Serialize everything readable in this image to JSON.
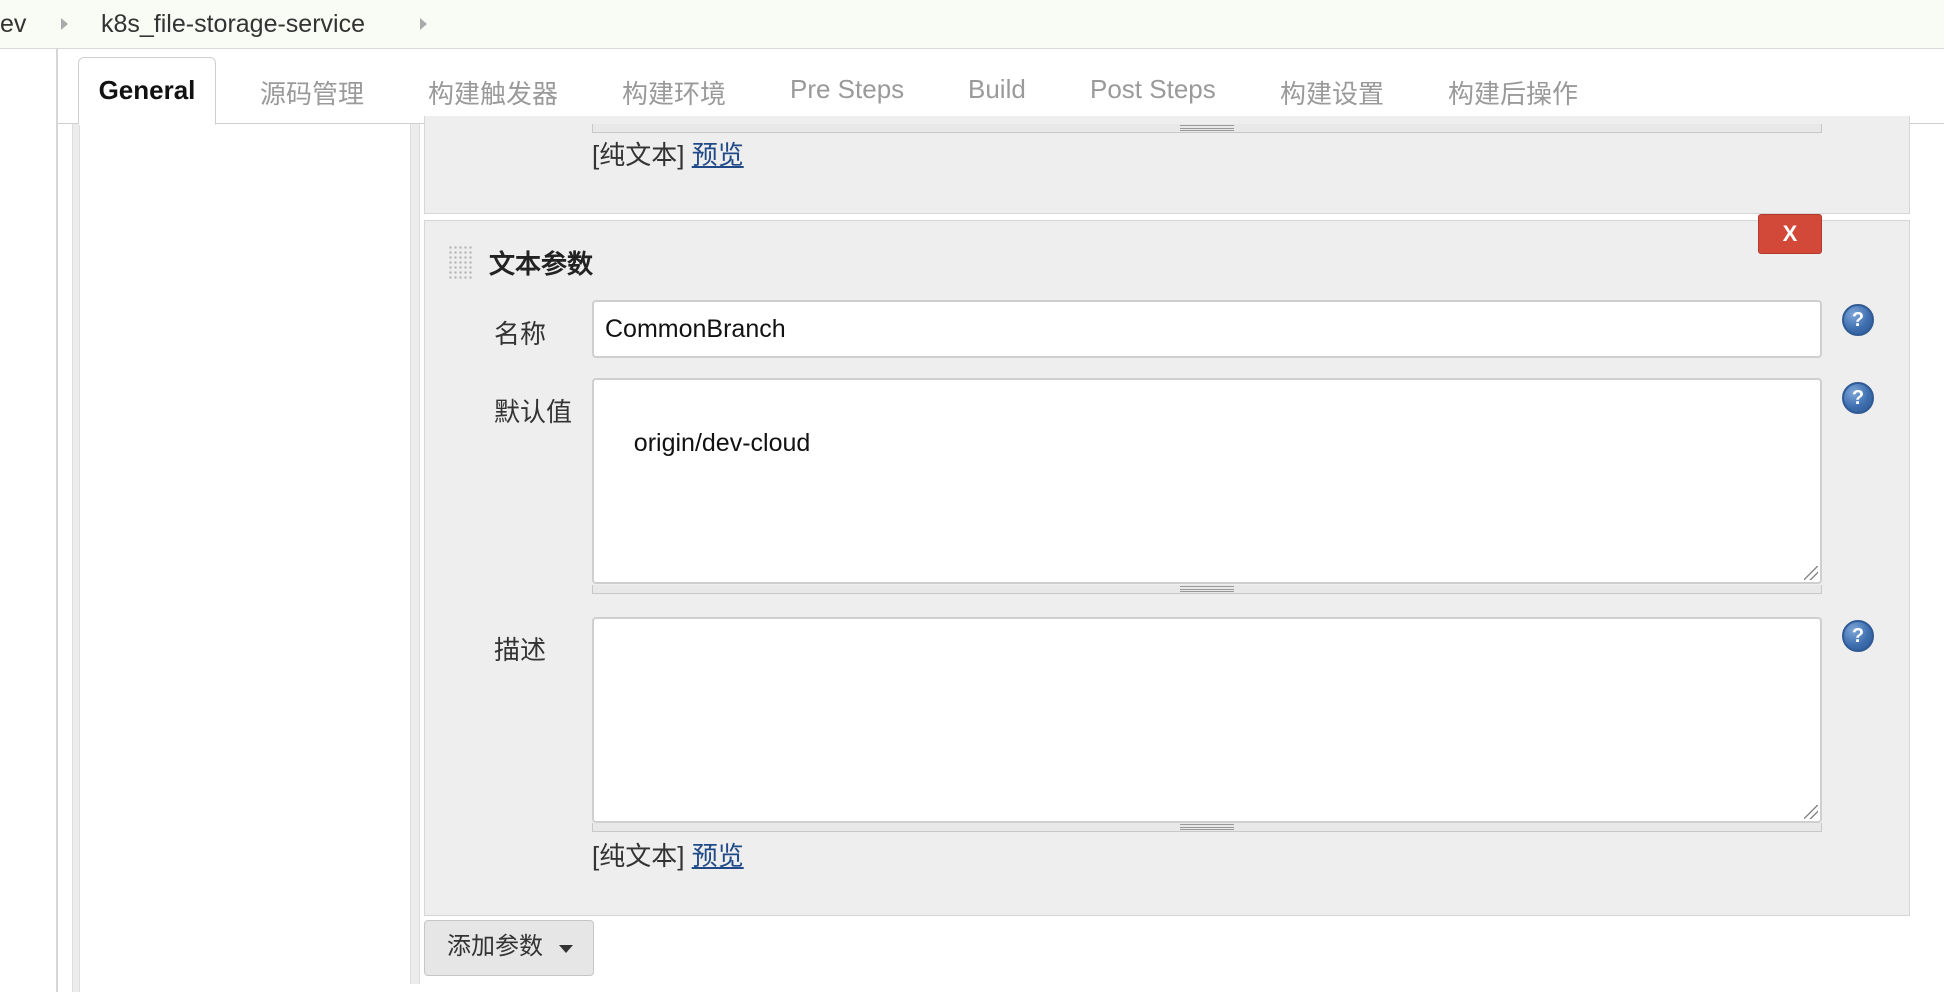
{
  "breadcrumb": {
    "items": [
      "ev",
      "k8s_file-storage-service"
    ]
  },
  "tabs": [
    {
      "label": "General",
      "active": true
    },
    {
      "label": "源码管理"
    },
    {
      "label": "构建触发器"
    },
    {
      "label": "构建环境"
    },
    {
      "label": "Pre Steps"
    },
    {
      "label": "Build"
    },
    {
      "label": "Post Steps"
    },
    {
      "label": "构建设置"
    },
    {
      "label": "构建后操作"
    }
  ],
  "previous_param": {
    "plain_text": "[纯文本]",
    "preview_link": "预览"
  },
  "text_param": {
    "title": "文本参数",
    "delete_label": "X",
    "name_label": "名称",
    "name_value": "CommonBranch",
    "default_label": "默认值",
    "default_value": "origin/dev-cloud",
    "desc_label": "描述",
    "desc_value": "",
    "plain_text": "[纯文本]",
    "preview_link": "预览"
  },
  "help_glyph": "?",
  "add_param_label": "添加参数",
  "icons": {
    "help": "help-icon",
    "breadcrumb_sep": "chevron-right-icon",
    "drag": "drag-handle-icon",
    "dropdown": "caret-down-icon"
  },
  "colors": {
    "delete_button": "#d24939",
    "help_icon": "#3f6fb0",
    "link": "#204a87",
    "breadcrumb_bg": "#f9fbf5"
  }
}
